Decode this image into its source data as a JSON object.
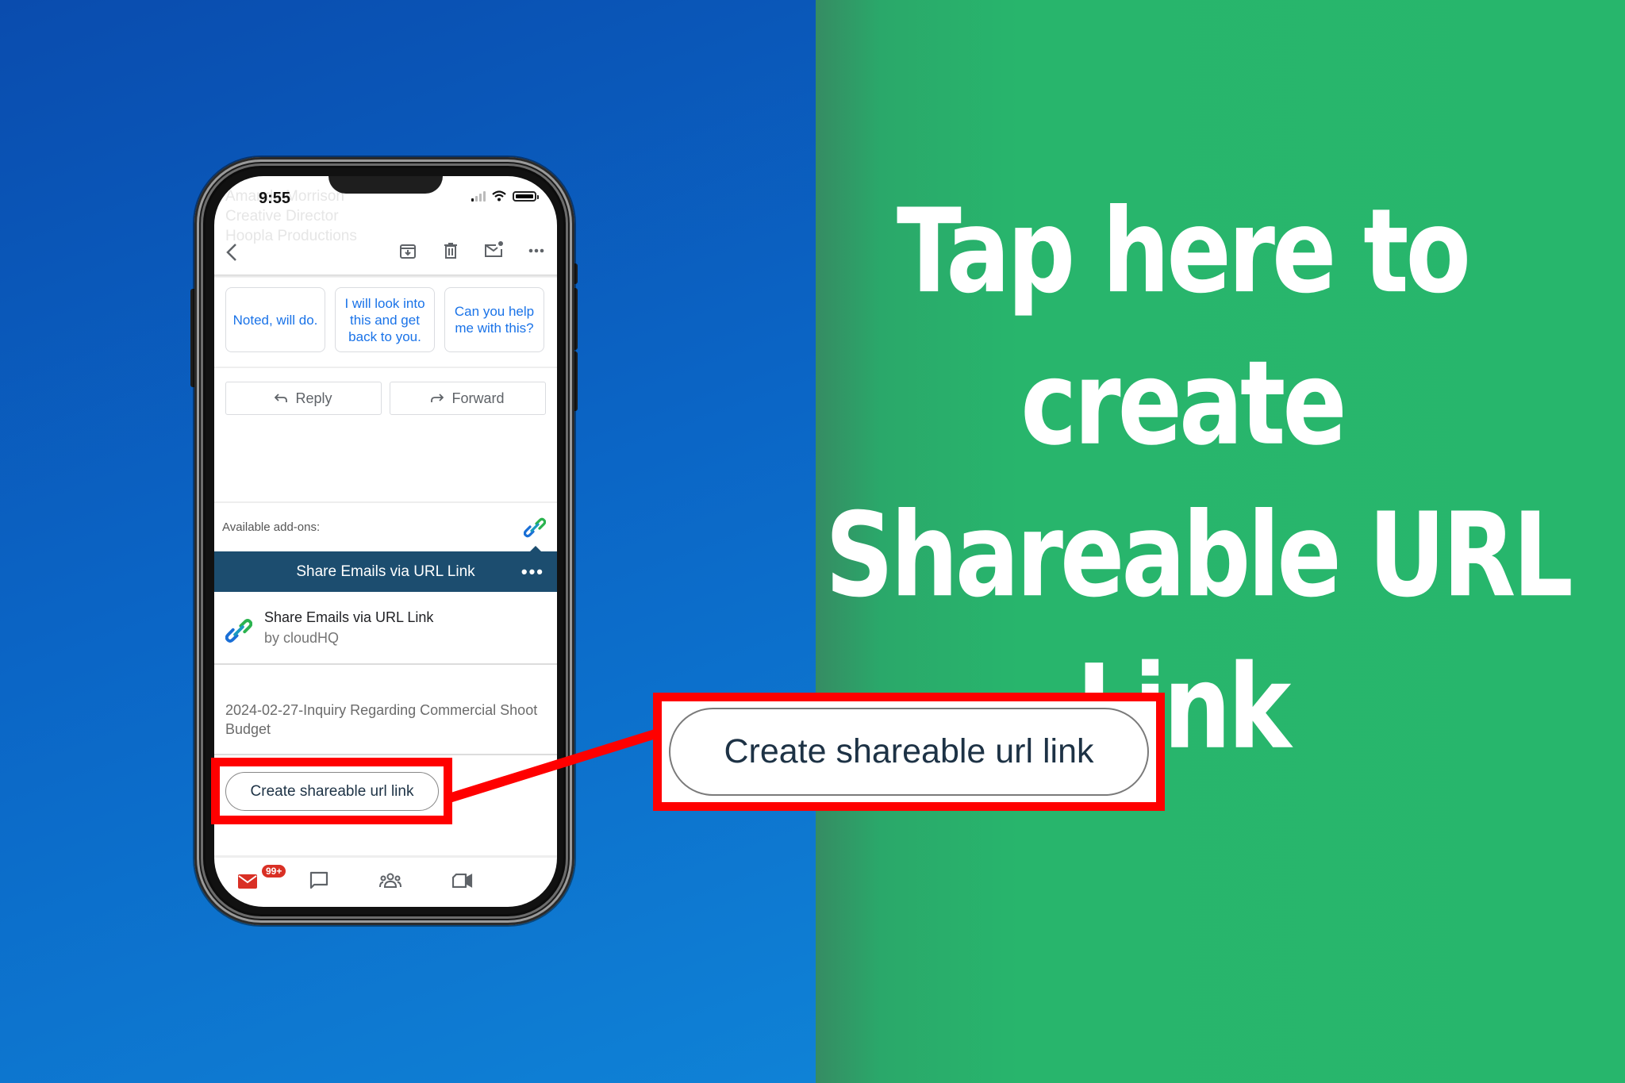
{
  "headline": {
    "lines": [
      "Tap here to",
      "create",
      "Shareable URL",
      "Link"
    ]
  },
  "colors": {
    "left_bg": "#0b66c6",
    "right_bg": "#27b66c",
    "highlight": "#ff0000",
    "banner": "#1c4d6f",
    "chip_text": "#1a73e8",
    "button_text": "#1d3245"
  },
  "phone": {
    "status_bar": {
      "time": "9:55"
    },
    "ghost_header": {
      "name": "Amanda Morrison",
      "title": "Creative Director",
      "company": "Hoopla Productions"
    },
    "toolbar": {
      "icons": [
        "back-chevron-icon",
        "archive-icon",
        "trash-icon",
        "mark-unread-icon",
        "more-icon"
      ]
    },
    "smart_replies": [
      "Noted, will do.",
      "I will look into this and get back to you.",
      "Can you help me with this?"
    ],
    "actions": {
      "reply": "Reply",
      "forward": "Forward"
    },
    "addons": {
      "label": "Available add-ons:",
      "banner_title": "Share Emails via URL Link",
      "addon_name": "Share Emails via URL Link",
      "addon_author": "by cloudHQ",
      "email_subject": "2024-02-27-Inquiry Regarding Commercial Shoot Budget",
      "create_button": "Create shareable url link"
    },
    "bottom_nav": {
      "mail_badge": "99+",
      "items": [
        "mail-icon",
        "chat-icon",
        "spaces-icon",
        "meet-icon"
      ]
    }
  },
  "callout": {
    "button_label": "Create shareable url link"
  }
}
